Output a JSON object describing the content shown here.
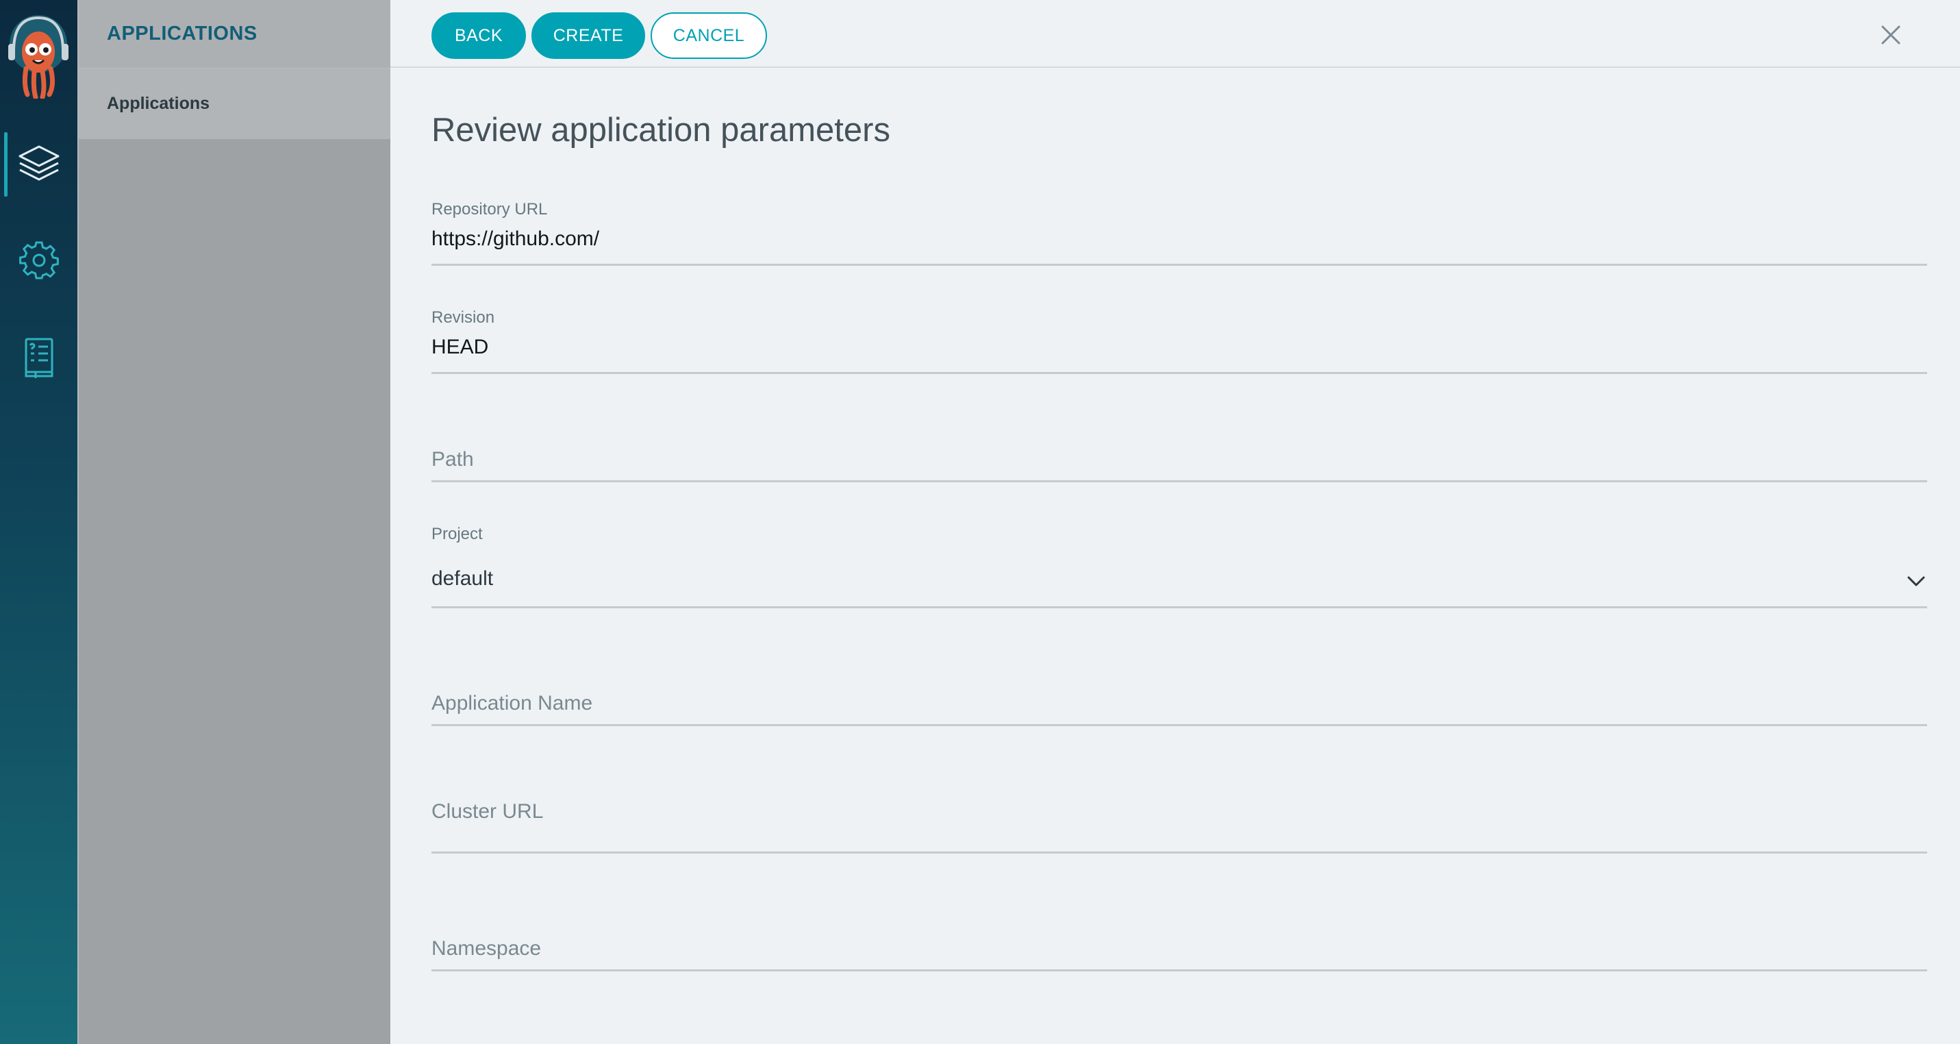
{
  "sidebar": {
    "nav": [
      {
        "icon": "layers-icon",
        "active": true
      },
      {
        "icon": "gear-icon",
        "active": false
      },
      {
        "icon": "book-icon",
        "active": false
      }
    ]
  },
  "side_panel": {
    "header": "APPLICATIONS",
    "items": [
      {
        "label": "Applications"
      }
    ]
  },
  "toolbar": {
    "back_label": "BACK",
    "create_label": "CREATE",
    "cancel_label": "CANCEL"
  },
  "main": {
    "title": "Review application parameters",
    "fields": {
      "repo_url": {
        "label": "Repository URL",
        "value": "https://github.com/"
      },
      "revision": {
        "label": "Revision",
        "value": "HEAD"
      },
      "path": {
        "placeholder": "Path"
      },
      "project": {
        "label": "Project",
        "value": "default"
      },
      "app_name": {
        "placeholder": "Application Name"
      },
      "cluster_url": {
        "placeholder": "Cluster URL"
      },
      "namespace": {
        "placeholder": "Namespace"
      }
    }
  },
  "colors": {
    "accent": "#00a2b3",
    "nav_dark": "#0b2a3f",
    "panel_grey": "#9ea2a4",
    "header_text": "#125e78"
  }
}
